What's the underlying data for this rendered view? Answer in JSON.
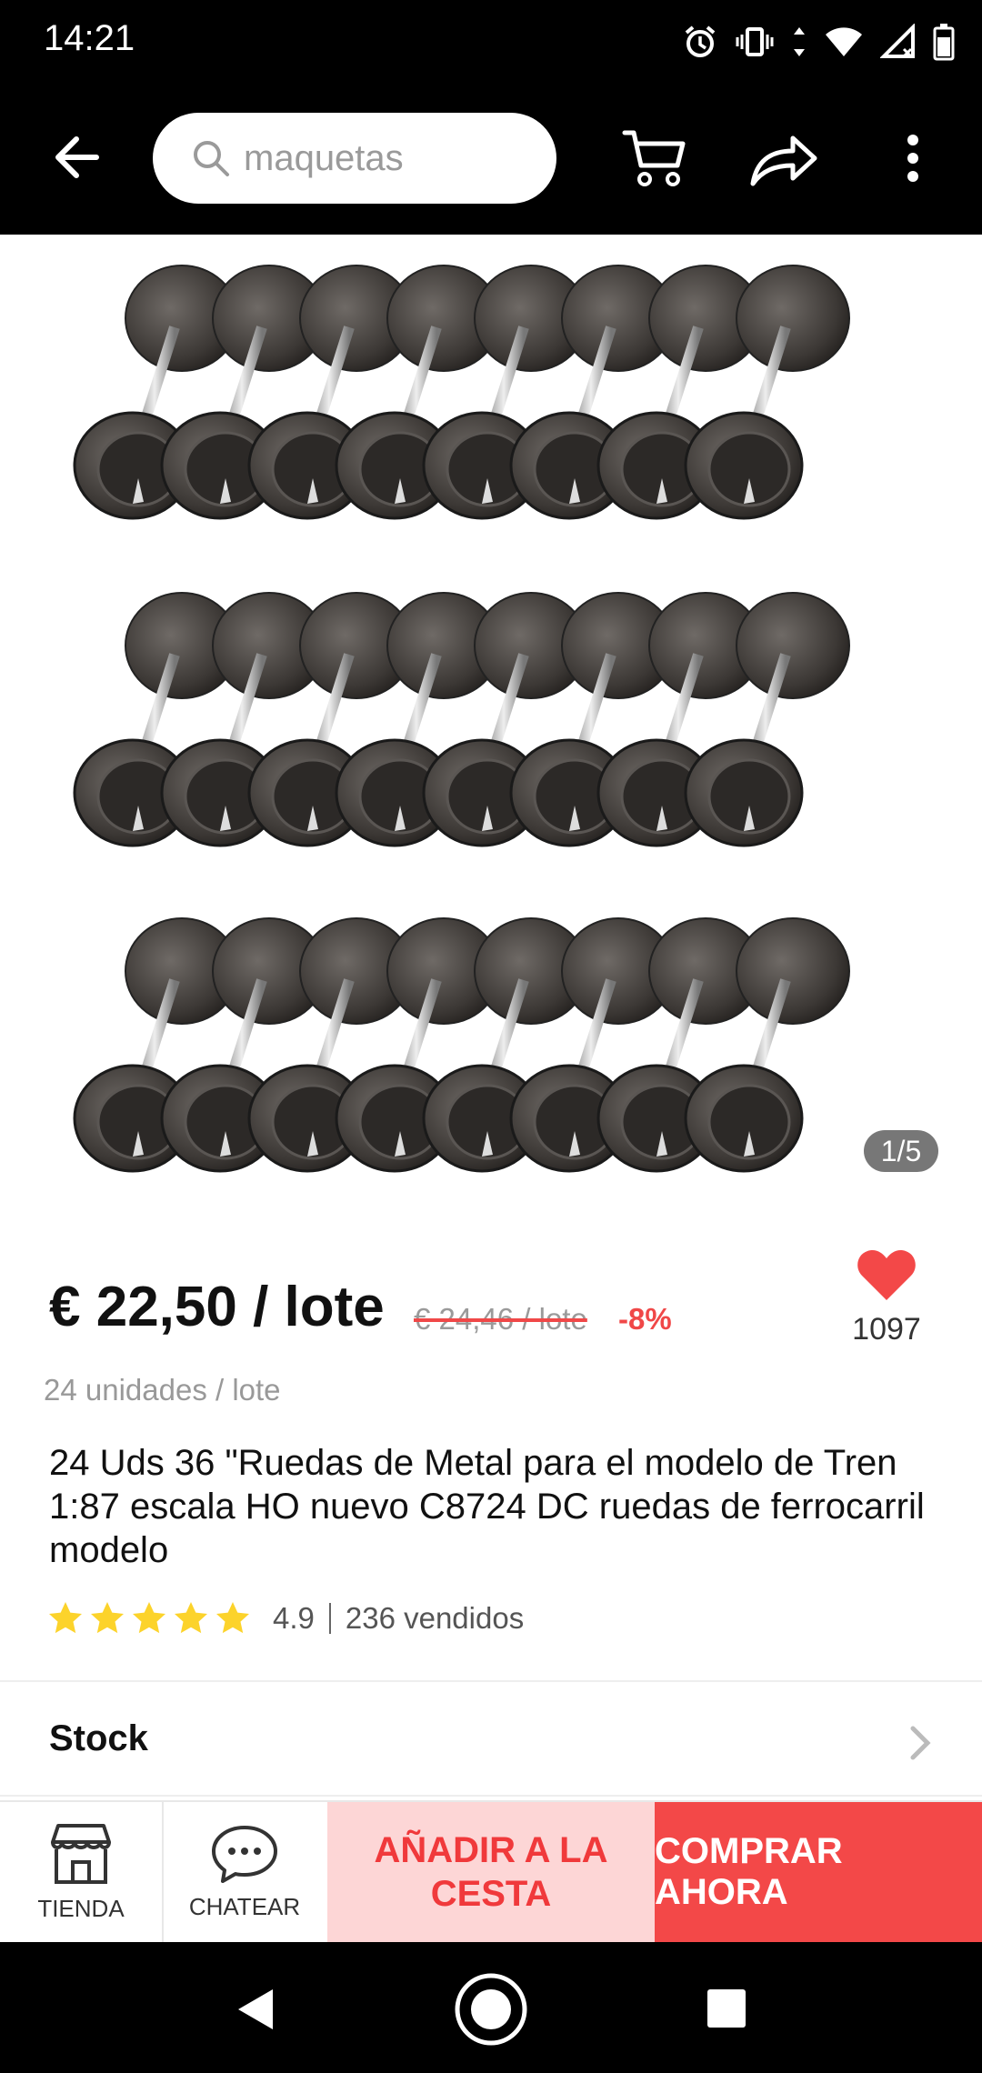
{
  "status": {
    "time": "14:21"
  },
  "search": {
    "text": "maquetas"
  },
  "gallery": {
    "indicator": "1/5"
  },
  "price": {
    "current": "€ 22,50 / lote",
    "original": "€ 24,46 / lote",
    "discount": "-8%",
    "units": "24 unidades / lote"
  },
  "wishlist": {
    "count": "1097"
  },
  "product": {
    "title": "24 Uds 36 \"Ruedas de Metal para el modelo de Tren 1:87 escala HO nuevo C8724 DC ruedas de ferrocarril modelo",
    "rating": "4.9",
    "rating_stars": 5,
    "sold": "236 vendidos"
  },
  "stock": {
    "label": "Stock"
  },
  "actions": {
    "store_label": "TIENDA",
    "chat_label": "CHATEAR",
    "add_label": "AÑADIR A LA CESTA",
    "buy_label": "COMPRAR AHORA"
  },
  "colors": {
    "accent": "#f34848",
    "accent_light": "#fdd6d6",
    "star": "#fcd32b"
  }
}
